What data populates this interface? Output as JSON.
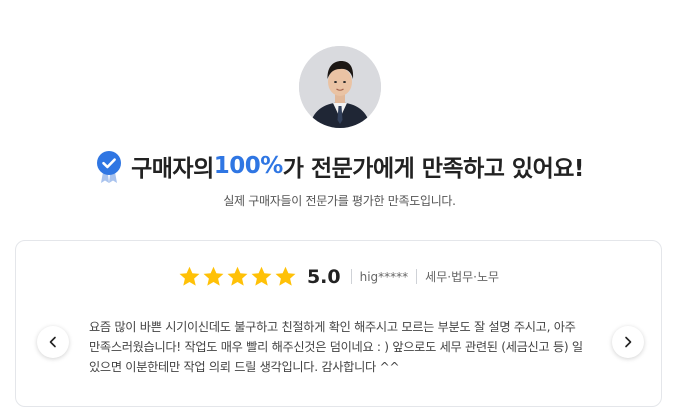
{
  "expert": {
    "avatar_icon": "expert-profile-photo"
  },
  "headline": {
    "prefix": "구매자의 ",
    "highlight": "100%",
    "suffix": "가 전문가에게 만족하고 있어요!",
    "icon": "verified-badge-icon"
  },
  "subtitle": "실제 구매자들이 전문가를 평가한 만족도입니다.",
  "review": {
    "stars": 5,
    "score": "5.0",
    "reviewer": "hig*****",
    "category": "세무·법무·노무",
    "text": "요즘 많이 바쁜 시기이신데도 불구하고 친절하게 확인 해주시고 모르는 부분도 잘 설명 주시고, 아주 만족스러웠습니다! 작업도 매우 빨리 해주신것은 덤이네요 : ) 앞으로도 세무 관련된 (세금신고 등) 일 있으면 이분한테만 작업 의뢰 드릴 생각입니다. 감사합니다 ^^"
  },
  "nav": {
    "prev_icon": "chevron-left-icon",
    "next_icon": "chevron-right-icon"
  },
  "colors": {
    "accent": "#2f76e3",
    "star": "#ffc107"
  }
}
